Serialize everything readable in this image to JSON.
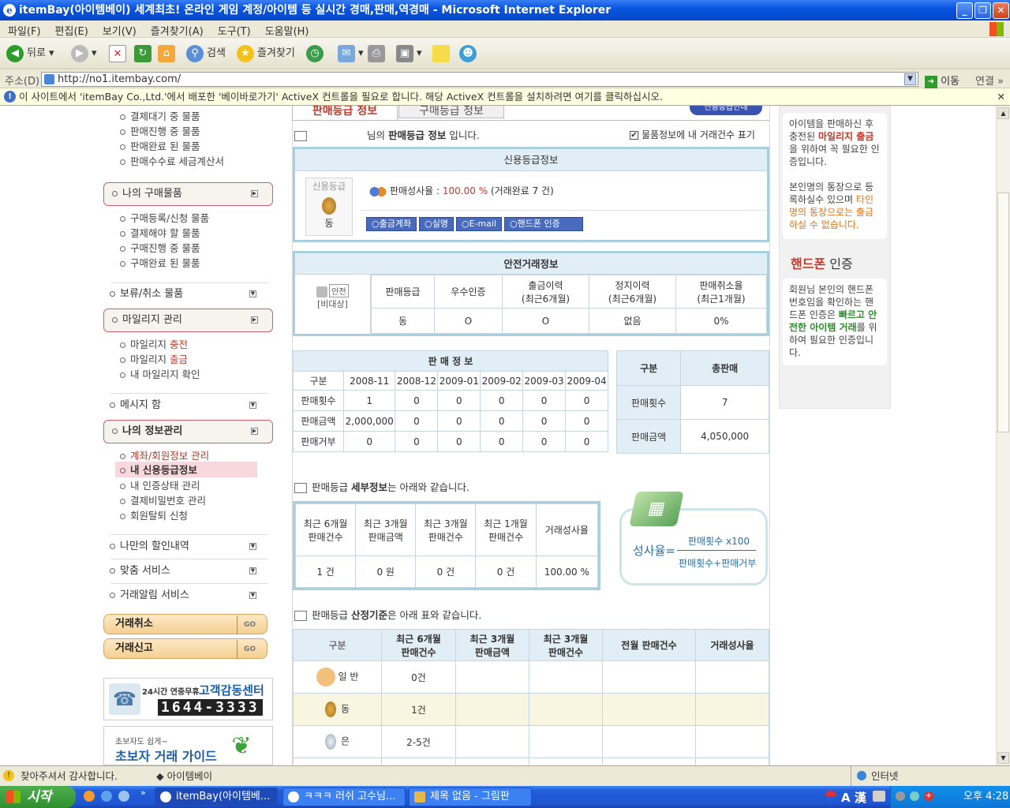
{
  "window": {
    "title": "itemBay(아이템베이) 세계최초! 온라인 게임 계정/아이템 등 실시간 경매,판매,역경매 - Microsoft Internet Explorer"
  },
  "menu": [
    "파일(F)",
    "편집(E)",
    "보기(V)",
    "즐겨찾기(A)",
    "도구(T)",
    "도움말(H)"
  ],
  "toolbar": {
    "back": "뒤로",
    "search": "검색",
    "favorites": "즐겨찾기"
  },
  "address": {
    "label": "주소(D)",
    "url": "http://no1.itembay.com/",
    "go": "이동",
    "links": "연결"
  },
  "infobar": "이 사이트에서 'itemBay Co.,Ltd.'에서 배포한 '베이바로가기' ActiveX 컨트롤을 필요로 합니다. 해당 ActiveX 컨트롤을 설치하려면 여기를 클릭하십시오.",
  "leftnav": {
    "sell_items": [
      "결제대기 중 물품",
      "판매진행 중 물품",
      "판매완료 된 물품",
      "판매수수료 세금계산서"
    ],
    "buy_header": "나의 구매물품",
    "buy_items": [
      "구매등록/신청 물품",
      "결제해야 할 물품",
      "구매진행 중 물품",
      "구매완료 된 물품"
    ],
    "hold": "보류/취소 물품",
    "mileage_header": "마일리지 관리",
    "mileage_items": [
      [
        "마일리지 ",
        "충전"
      ],
      [
        "마일리지 ",
        "출금"
      ],
      [
        "내 마일리지 확인",
        ""
      ]
    ],
    "message": "메시지 함",
    "info_header": "나의 정보관리",
    "info_items": [
      "계좌/회원정보 관리",
      "내 신용등급정보",
      "내 인증상태 관리",
      "결제비밀번호 관리",
      "회원탈퇴 신청"
    ],
    "discount": "나만의 할인내역",
    "custom": "맞춤 서비스",
    "alarm": "거래알림 서비스",
    "cancel_btn": "거래취소",
    "report_btn": "거래신고",
    "go": "GO",
    "cs_title": "고객감동센터",
    "cs_sub": "24시간 연중무휴",
    "cs_phone": "1644-3333",
    "guide_small": "초보자도 쉽게~",
    "guide_big": "초보자 거래 가이드"
  },
  "tabs": {
    "sell": "판매등급 정보",
    "buy": "구매등급 정보",
    "credit_btn": "신용등급안내"
  },
  "header": {
    "suffix": "님의 ",
    "bold": "판매등급 정보",
    "rest": " 입니다.",
    "checkbox": "물품정보에 내 거래건수 표기"
  },
  "credit": {
    "title": "신용등급정보",
    "grade_label": "신용등급",
    "grade": "동",
    "rate_label": "판매성사율 :",
    "rate": "100.00 %",
    "rate_extra": "(거래완료 7 건)",
    "buttons": [
      "출금계좌",
      "실명",
      "E-mail",
      "핸드폰 인증"
    ]
  },
  "safe": {
    "title": "안전거래정보",
    "icon_label": "안전",
    "icon_sub": "[비대상]",
    "cols": [
      "판매등급",
      "우수인증",
      "출금이력\n(최근6개월)",
      "정지이력\n(최근6개월)",
      "판매취소율\n(최근1개월)"
    ],
    "vals": [
      "동",
      "O",
      "O",
      "없음",
      "0%"
    ]
  },
  "salesinfo": {
    "title": "판 매 정 보",
    "cols": [
      "구분",
      "2008-11",
      "2008-12",
      "2009-01",
      "2009-02",
      "2009-03",
      "2009-04"
    ],
    "rows": [
      [
        "판매횟수",
        "1",
        "0",
        "0",
        "0",
        "0",
        "0"
      ],
      [
        "판매금액",
        "2,000,000",
        "0",
        "0",
        "0",
        "0",
        "0"
      ],
      [
        "판매거부",
        "0",
        "0",
        "0",
        "0",
        "0",
        "0"
      ]
    ]
  },
  "total": {
    "cols": [
      "구분",
      "총판매"
    ],
    "rows": [
      [
        "판매횟수",
        "7"
      ],
      [
        "판매금액",
        "4,050,000"
      ]
    ]
  },
  "detail": {
    "text1": "판매등급 ",
    "bold": "세부정보",
    "text2": "는 아래와 같습니다.",
    "cols": [
      "최근 6개월\n판매건수",
      "최근 3개월\n판매금액",
      "최근 3개월\n판매건수",
      "최근 1개월\n판매건수",
      "거래성사율"
    ],
    "vals": [
      "1 건",
      "0 원",
      "0 건",
      "0 건",
      "100.00 %"
    ],
    "formula_lhs": "성사율=",
    "formula_num": "판매횟수 x100",
    "formula_den": "판매횟수+판매거부"
  },
  "criteria": {
    "text1": "판매등급 ",
    "bold": "산정기준",
    "text2": "은 아래 표와 같습니다.",
    "cols": [
      "구분",
      "최근 6개월\n판매건수",
      "최근 3개월\n판매금액",
      "최근 3개월\n판매건수",
      "전월 판매건수",
      "거래성사율"
    ],
    "rows": [
      [
        "일 반",
        "0건"
      ],
      [
        "동",
        "1건"
      ],
      [
        "은",
        "2-5건"
      ]
    ]
  },
  "rightbar": {
    "p1a": "아이템을 판매하신 후 충전된 ",
    "p1b": "마일리지 출금",
    "p1c": "을 위하여 꼭 필요한 인증입니다.",
    "p2a": "본인명의 통장으로 등록하실수 있으며 ",
    "p2b": "타인 명의 통장으로는 출금 하실 수 없습니다.",
    "phone_title_a": "핸드폰",
    "phone_title_b": " 인증",
    "p3a": "회원님 본인의 핸드폰 번호임을 확인하는 핸드폰 인증은 ",
    "p3b": "빠르고 안전한 아이템 거래",
    "p3c": "를 위하여 필요한 인증입니다."
  },
  "status": {
    "left": "찾아주셔서 감사합니다.",
    "mid": "◆ 아이템베이",
    "zone": "인터넷"
  },
  "taskbar": {
    "start": "시작",
    "tasks": [
      "itemBay(아이템베...",
      "ㅋㅋㅋ 러쉬 고수님...",
      "제목 없음 - 그림판"
    ],
    "ime": "A 漢",
    "clock": "오후 4:28"
  },
  "colors": {
    "accent_red": "#c0392b",
    "accent_orange": "#e8731a",
    "teal": "#a9d0de"
  }
}
